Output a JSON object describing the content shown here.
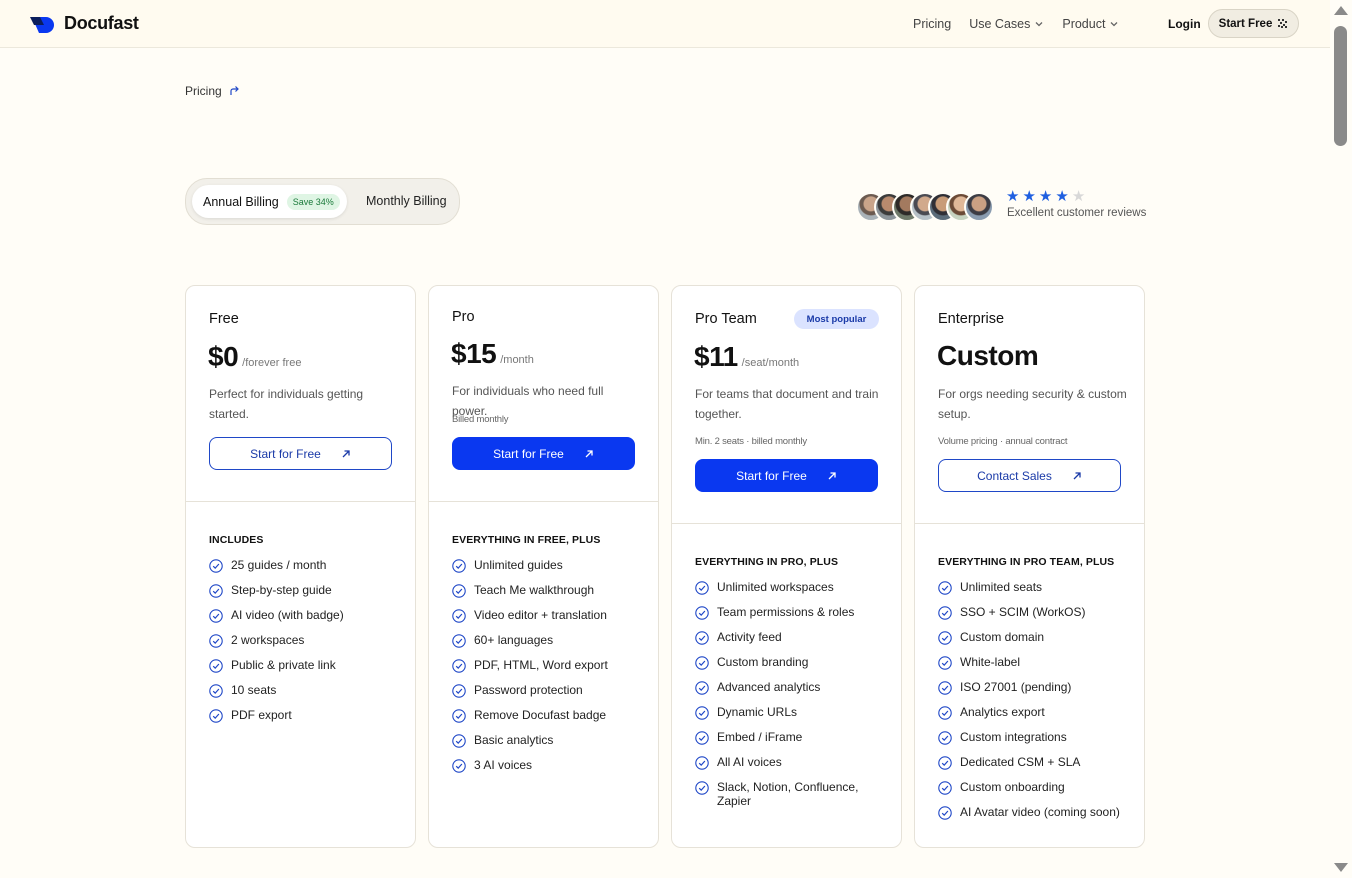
{
  "header": {
    "brand": "Docufast",
    "nav": [
      {
        "label": "Pricing",
        "dropdown": false
      },
      {
        "label": "Use Cases",
        "dropdown": true
      },
      {
        "label": "Product",
        "dropdown": true
      }
    ],
    "login": "Login",
    "start_free": "Start Free"
  },
  "breadcrumb": {
    "label": "Pricing"
  },
  "billing": {
    "annual": "Annual Billing",
    "save_badge": "Save 34%",
    "monthly": "Monthly Billing",
    "selected": "annual"
  },
  "reviews": {
    "rating": 4,
    "max": 5,
    "label": "Excellent customer reviews"
  },
  "plans": [
    {
      "name": "Free",
      "price": "$0",
      "unit": "/forever free",
      "description": "Perfect for individuals getting started.",
      "note": "",
      "cta": "Start for Free",
      "features_title": "INCLUDES",
      "features": [
        "25 guides / month",
        "Step-by-step guide",
        "AI video (with badge)",
        "2 workspaces",
        "Public & private link",
        "10 seats",
        "PDF export"
      ]
    },
    {
      "name": "Pro",
      "price": "$15",
      "unit": "/month",
      "description": "For individuals who need full power.",
      "note": "Billed monthly",
      "cta": "Start for Free",
      "features_title": "EVERYTHING IN FREE, PLUS",
      "features": [
        "Unlimited guides",
        "Teach Me walkthrough",
        "Video editor + translation",
        "60+ languages",
        "PDF, HTML, Word export",
        "Password protection",
        "Remove Docufast badge",
        "Basic analytics",
        "3 AI voices"
      ]
    },
    {
      "name": "Pro Team",
      "badge": "Most popular",
      "price": "$11",
      "unit": "/seat/month",
      "description": "For teams that document and train together.",
      "note": "Min. 2 seats · billed monthly",
      "cta": "Start for Free",
      "features_title": "EVERYTHING IN PRO, PLUS",
      "features": [
        "Unlimited workspaces",
        "Team permissions & roles",
        "Activity feed",
        "Custom branding",
        "Advanced analytics",
        "Dynamic URLs",
        "Embed / iFrame",
        "All AI voices",
        "Slack, Notion, Confluence, Zapier"
      ]
    },
    {
      "name": "Enterprise",
      "price": "Custom",
      "unit": "",
      "description": "For orgs needing security & custom setup.",
      "note": "Volume pricing · annual contract",
      "cta": "Contact Sales",
      "features_title": "EVERYTHING IN PRO TEAM, PLUS",
      "features": [
        "Unlimited seats",
        "SSO + SCIM (WorkOS)",
        "Custom domain",
        "White-label",
        "ISO 27001 (pending)",
        "Analytics export",
        "Custom integrations",
        "Dedicated CSM + SLA",
        "Custom onboarding",
        "AI Avatar video (coming soon)"
      ]
    }
  ],
  "colors": {
    "accent": "#0a38f0",
    "background": "#fffdf7",
    "badge_bg": "#dbe3ff",
    "save_green": "#1a7a3a"
  }
}
